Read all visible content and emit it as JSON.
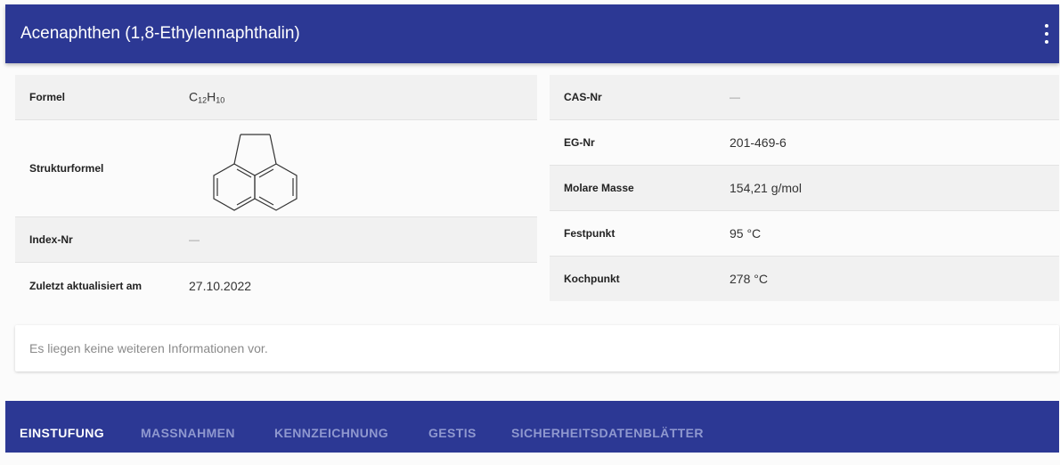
{
  "header": {
    "title": "Acenaphthen (1,8-Ethylennaphthalin)",
    "menu_icon": "more-vert-icon"
  },
  "left_table": {
    "formel_label": "Formel",
    "formel": {
      "c": "C",
      "c_sub": "12",
      "h": "H",
      "h_sub": "10"
    },
    "strukturformel_label": "Strukturformel",
    "index_label": "Index-Nr",
    "index_value": "—",
    "updated_label": "Zuletzt aktualisiert am",
    "updated_value": "27.10.2022"
  },
  "right_table": {
    "rows": [
      {
        "label": "CAS-Nr",
        "value": "—"
      },
      {
        "label": "EG-Nr",
        "value": "201-469-6"
      },
      {
        "label": "Molare Masse",
        "value": "154,21 g/mol"
      },
      {
        "label": "Festpunkt",
        "value": "95 °C"
      },
      {
        "label": "Kochpunkt",
        "value": "278 °C"
      }
    ]
  },
  "info": {
    "text": "Es liegen keine weiteren Informationen vor."
  },
  "tabs": [
    {
      "label": "EINSTUFUNG",
      "active": true
    },
    {
      "label": "MASSNAHMEN",
      "active": false
    },
    {
      "label": "KENNZEICHNUNG",
      "active": false
    },
    {
      "label": "GESTIS",
      "active": false
    },
    {
      "label": "SICHERHEITSDATENBLÄTTER",
      "active": false
    }
  ],
  "colors": {
    "primary": "#2c3894",
    "tab_inactive": "#8f98cf",
    "tab_active": "#ffffff"
  }
}
